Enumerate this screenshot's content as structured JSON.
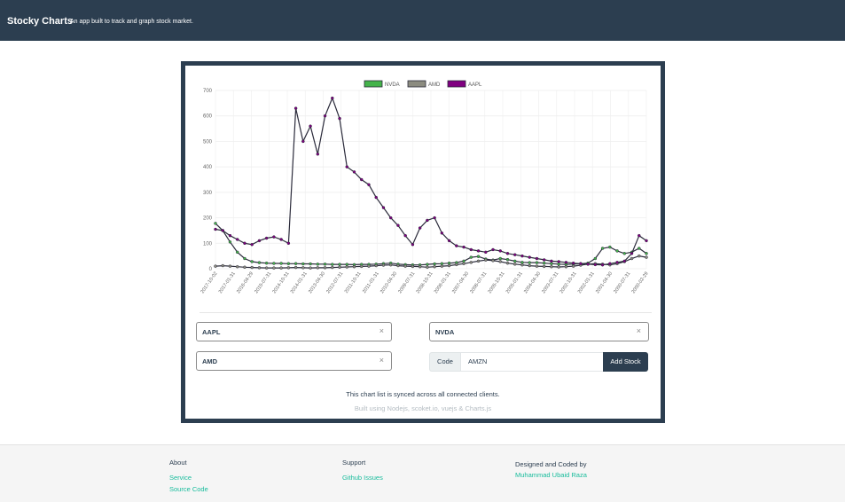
{
  "header": {
    "brand": "Stocky Charts",
    "tagline": "An app built to track and graph stock market."
  },
  "colors": {
    "navy": "#2c3e50",
    "NVDA": "#44b34a",
    "AMD": "#8c8c80",
    "AAPL": "#800080",
    "link": "#18bc9c"
  },
  "chart_data": {
    "type": "line",
    "legend_position": "top",
    "grid": true,
    "ylim": [
      0,
      700
    ],
    "y_ticks": [
      "0",
      "100",
      "200",
      "300",
      "400",
      "500",
      "600",
      "700"
    ],
    "x_ticks": [
      "2017-10-02",
      "2017-01-31",
      "2016-04-29",
      "2015-07-31",
      "2014-10-31",
      "2014-01-31",
      "2013-04-30",
      "2012-07-31",
      "2011-10-31",
      "2011-01-31",
      "2010-04-30",
      "2009-07-31",
      "2008-10-31",
      "2008-01-31",
      "2007-04-30",
      "2006-07-31",
      "2005-10-31",
      "2005-01-31",
      "2004-04-30",
      "2003-07-31",
      "2002-10-31",
      "2002-01-31",
      "2001-04-30",
      "2000-07-31",
      "2000-02-29"
    ],
    "series": [
      {
        "name": "NVDA",
        "color": "#44b34a",
        "values": [
          178,
          150,
          105,
          65,
          40,
          28,
          24,
          22,
          21,
          21,
          20,
          20,
          19,
          19,
          18,
          18,
          17,
          17,
          17,
          16,
          17,
          17,
          18,
          20,
          22,
          18,
          16,
          15,
          15,
          17,
          19,
          20,
          22,
          24,
          30,
          45,
          48,
          38,
          34,
          40,
          36,
          30,
          25,
          24,
          24,
          22,
          20,
          18,
          17,
          18,
          20,
          22,
          40,
          80,
          85,
          70,
          60,
          65,
          80,
          60
        ]
      },
      {
        "name": "AMD",
        "color": "#8c8c80",
        "values": [
          10,
          12,
          10,
          8,
          6,
          5,
          4,
          3,
          3,
          3,
          4,
          5,
          4,
          3,
          4,
          4,
          5,
          6,
          7,
          8,
          9,
          10,
          12,
          14,
          15,
          12,
          10,
          9,
          8,
          6,
          8,
          10,
          12,
          16,
          20,
          25,
          30,
          34,
          32,
          28,
          22,
          18,
          15,
          12,
          10,
          9,
          8,
          7,
          8,
          10,
          14,
          18,
          20,
          18,
          15,
          20,
          28,
          40,
          50,
          45
        ]
      },
      {
        "name": "AAPL",
        "color": "#800080",
        "values": [
          155,
          150,
          130,
          115,
          100,
          95,
          110,
          120,
          125,
          115,
          100,
          630,
          500,
          560,
          450,
          600,
          670,
          590,
          400,
          380,
          350,
          330,
          280,
          240,
          200,
          170,
          130,
          95,
          160,
          190,
          200,
          140,
          110,
          90,
          85,
          75,
          70,
          65,
          75,
          70,
          60,
          55,
          50,
          45,
          40,
          35,
          30,
          28,
          25,
          22,
          20,
          18,
          16,
          15,
          20,
          25,
          30,
          60,
          130,
          110
        ]
      }
    ]
  },
  "stocks": {
    "chip1": "AAPL",
    "chip2": "NVDA",
    "chip3": "AMD",
    "remove": "×"
  },
  "add": {
    "code_label": "Code",
    "code_value": "AMZN",
    "button": "Add Stock"
  },
  "notes": {
    "sync": "This chart list is synced across all connected clients.",
    "built": "Built using Nodejs, scoket.io, vuejs & Charts.js"
  },
  "footer": {
    "about_title": "About",
    "service": "Service",
    "source": "Source Code",
    "support_title": "Support",
    "issues": "Github Issues",
    "designed": "Designed and Coded by",
    "author": "Muhammad Ubaid Raza"
  }
}
